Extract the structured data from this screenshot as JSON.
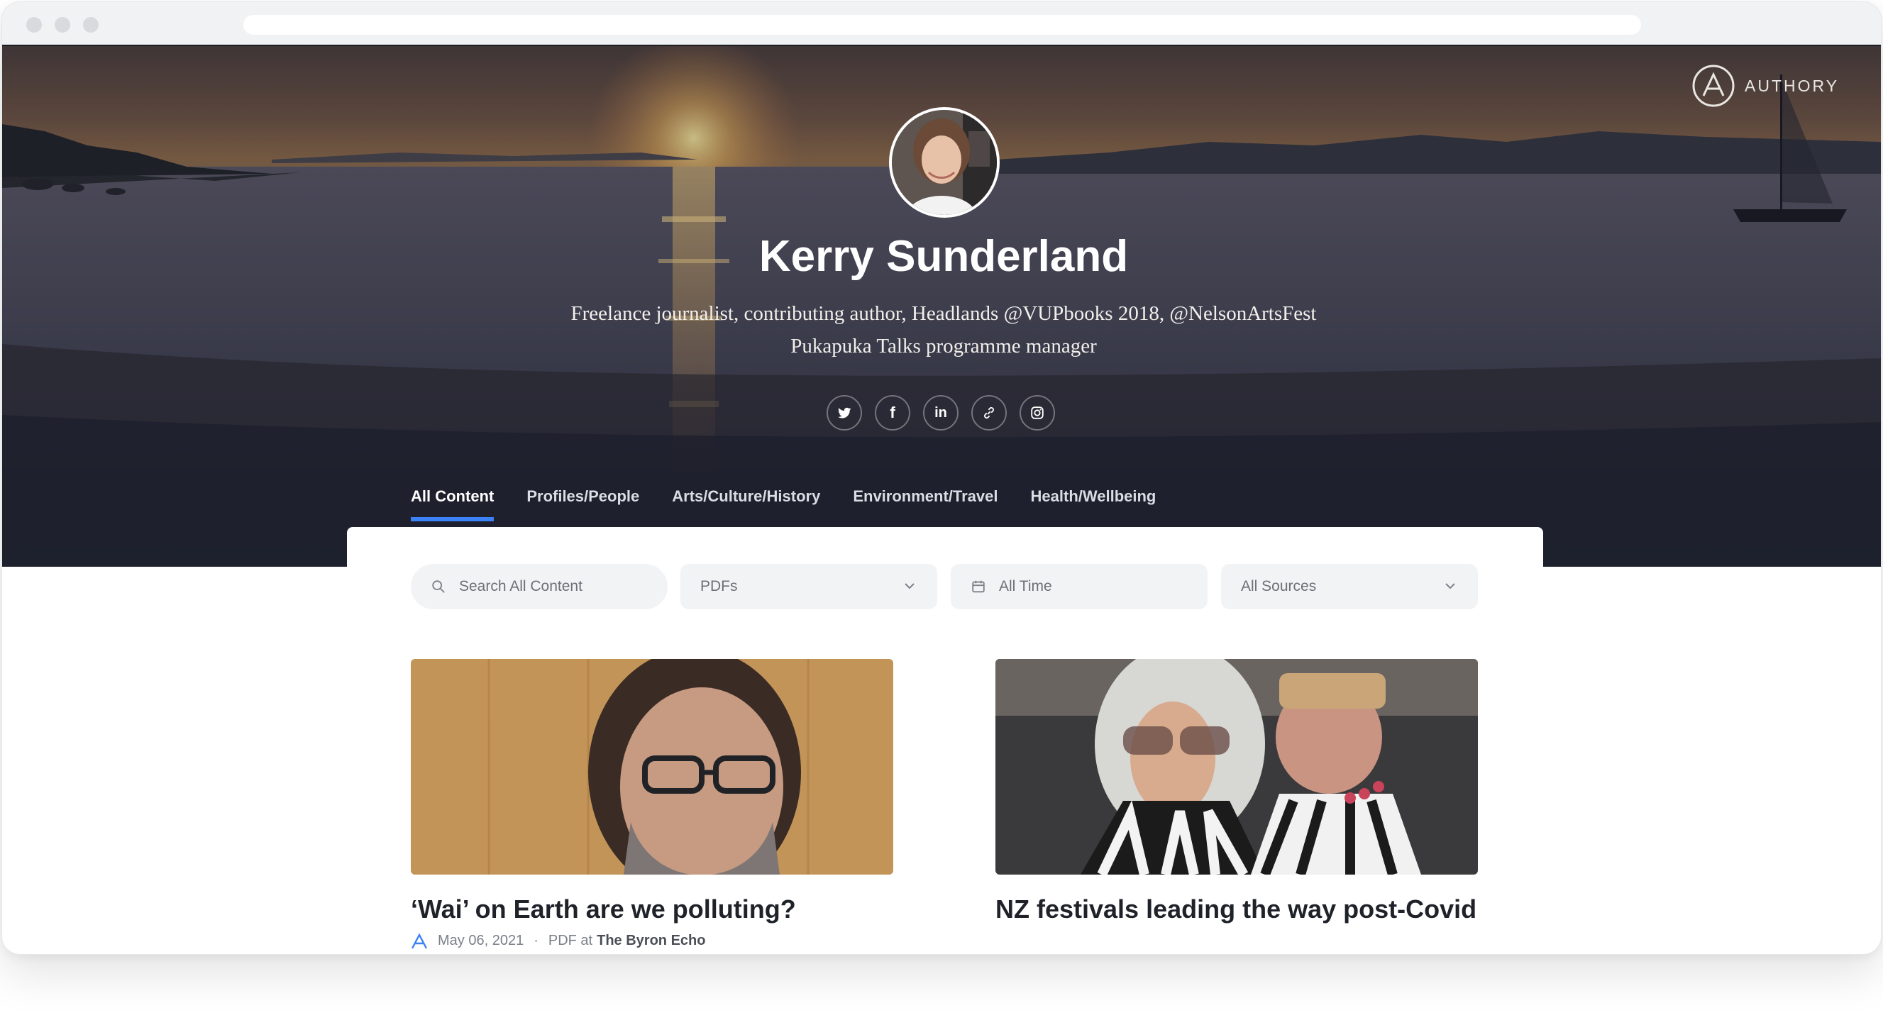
{
  "brand": {
    "logo_text": "AUTHORY"
  },
  "profile": {
    "name": "Kerry Sunderland",
    "bio_line1": "Freelance journalist, contributing author, Headlands @VUPbooks 2018, @NelsonArtsFest",
    "bio_line2": "Pukapuka Talks programme manager"
  },
  "social_icons": [
    "twitter-icon",
    "facebook-icon",
    "linkedin-icon",
    "link-icon",
    "instagram-icon"
  ],
  "social_glyphs": {
    "facebook": "f",
    "linkedin": "in"
  },
  "tabs": [
    {
      "label": "All Content",
      "active": true
    },
    {
      "label": "Profiles/People",
      "active": false
    },
    {
      "label": "Arts/Culture/History",
      "active": false
    },
    {
      "label": "Environment/Travel",
      "active": false
    },
    {
      "label": "Health/Wellbeing",
      "active": false
    }
  ],
  "filters": {
    "search_placeholder": "Search All Content",
    "type_value": "PDFs",
    "time_value": "All Time",
    "sources_value": "All Sources"
  },
  "articles": [
    {
      "title": "‘Wai’ on Earth are we polluting?",
      "date": "May 06, 2021",
      "type_prefix": "PDF at",
      "source": "The Byron Echo",
      "separator": "·"
    },
    {
      "title": "NZ festivals leading the way post-Covid"
    }
  ],
  "colors": {
    "accent": "#3b82f6",
    "hero_dark": "#1d2230",
    "title_text": "#1f2329",
    "filter_bg": "#f2f3f5"
  }
}
